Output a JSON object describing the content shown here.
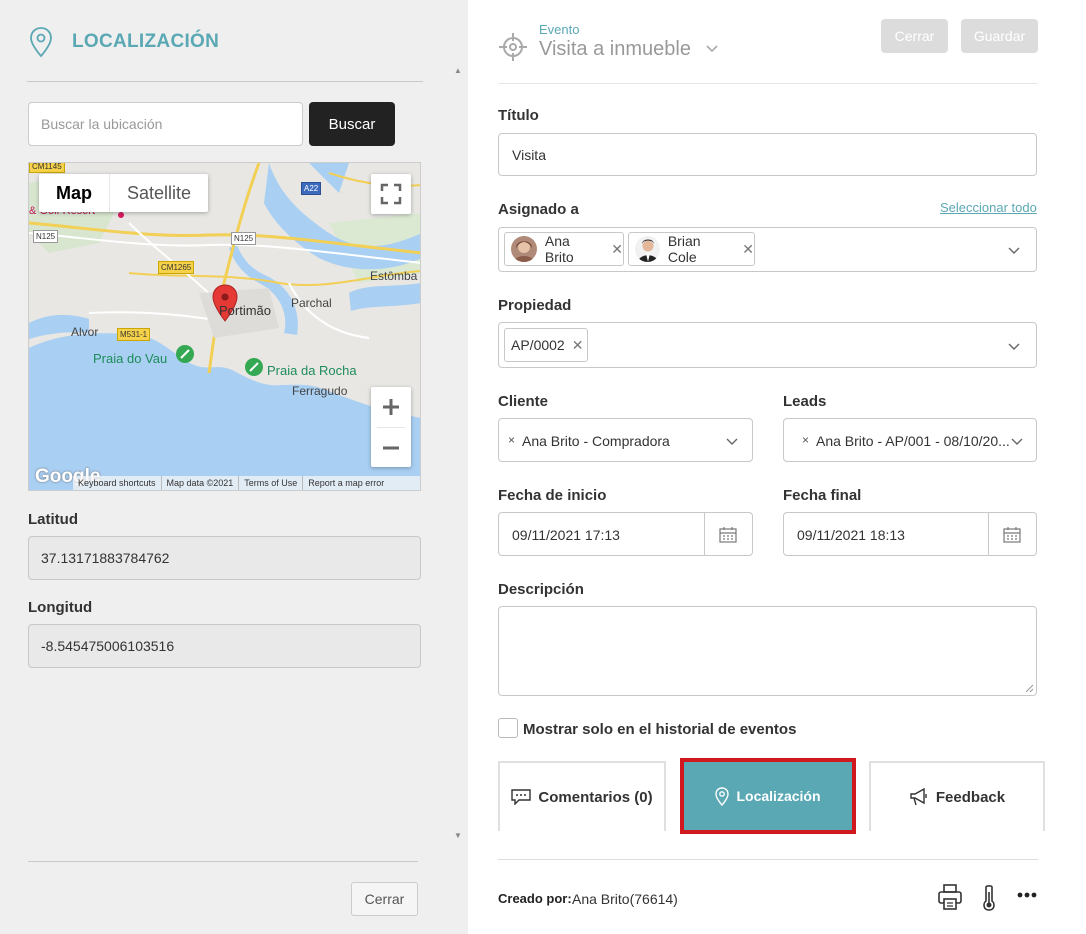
{
  "left": {
    "title": "LOCALIZACIÓN",
    "search": {
      "placeholder": "Buscar la ubicación",
      "button": "Buscar"
    },
    "map": {
      "type_map": "Map",
      "type_satellite": "Satellite",
      "places": [
        "Portimão",
        "Alvor",
        "Parchal",
        "Estômba",
        "Praia do Vau",
        "Praia da Rocha",
        "Ferragudo",
        "& Golf Resort"
      ],
      "roads": [
        "CM1145",
        "A22",
        "N125",
        "N125",
        "CM1265",
        "M531-1"
      ],
      "footer": [
        "Keyboard shortcuts",
        "Map data ©2021",
        "Terms of Use",
        "Report a map error"
      ],
      "logo": "Google"
    },
    "latitude": {
      "label": "Latitud",
      "value": "37.13171883784762"
    },
    "longitude": {
      "label": "Longitud",
      "value": "-8.545475006103516"
    },
    "close": "Cerrar"
  },
  "right": {
    "header": {
      "small": "Evento",
      "type": "Visita a inmueble",
      "close": "Cerrar",
      "save": "Guardar"
    },
    "title_label": "Título",
    "title_value": "Visita",
    "assigned_label": "Asignado a",
    "select_all": "Seleccionar todo",
    "assigned": [
      "Ana Brito",
      "Brian Cole"
    ],
    "property_label": "Propiedad",
    "property": "AP/0002",
    "client_label": "Cliente",
    "client": "Ana Brito - Compradora",
    "leads_label": "Leads",
    "leads": "Ana Brito - AP/001 - 08/10/20...",
    "start_label": "Fecha de inicio",
    "start_value": "09/11/2021 17:13",
    "end_label": "Fecha final",
    "end_value": "09/11/2021 18:13",
    "desc_label": "Descripción",
    "history_label": "Mostrar solo en el historial de eventos",
    "tabs": {
      "comments": "Comentarios (0)",
      "location": "Localización",
      "feedback": "Feedback"
    },
    "created_label": "Creado por:",
    "created_value": "Ana Brito(76614)",
    "colors": {
      "accent": "#5aa8b4",
      "highlight": "#d0181f"
    }
  }
}
